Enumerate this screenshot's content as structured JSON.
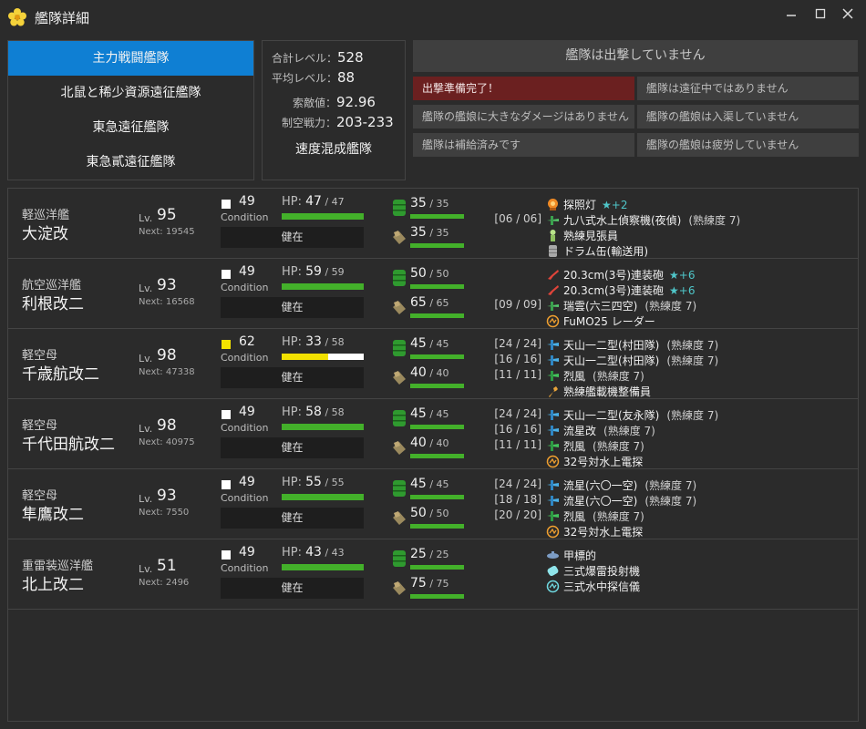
{
  "window": {
    "title": "艦隊詳細",
    "minimize": "─",
    "maximize": "☐",
    "close": "✕"
  },
  "fleets": [
    "主力戦闘艦隊",
    "北鼠と稀少資源遠征艦隊",
    "東急遠征艦隊",
    "東急貳遠征艦隊"
  ],
  "stats": {
    "total_level_label": "合計レベル：",
    "total_level": "528",
    "avg_level_label": "平均レベル：",
    "avg_level": "88",
    "los_label": "索敵値：",
    "los": "92.96",
    "air_label": "制空戦力：",
    "air": "203-233",
    "fleet_type": "速度混成艦隊"
  },
  "status": {
    "sortie": "艦隊は出撃していません",
    "ready": "出撃準備完了！",
    "expedition": "艦隊は遠征中ではありません",
    "damage": "艦隊の艦娘に大きなダメージはありません",
    "repair": "艦隊の艦娘は入渠していません",
    "supply": "艦隊は補給済みです",
    "fatigue": "艦隊の艦娘は疲労していません"
  },
  "labels": {
    "lv": "Lv.",
    "condition": "Condition",
    "hp": "HP:",
    "slash": " / "
  },
  "colors": {
    "accent": "#0f7fd3",
    "bar": "#43b02a",
    "alert": "#6b2020",
    "star": "#4fc6c9"
  },
  "ships": [
    {
      "type": "軽巡洋艦",
      "name": "大淀改",
      "lv": "95",
      "next": "Next: 19545",
      "cond": "49",
      "cond_color": "white",
      "status": "健在",
      "hp": "47",
      "hp_max": "47",
      "hp_fraction": 1.0,
      "hp_color": "green",
      "fuel": "35",
      "fuel_max": "35",
      "ammo": "35",
      "ammo_max": "35",
      "equip": [
        {
          "slot": "",
          "icon": "searchlight-icon",
          "name": "探照灯",
          "stars": "★+2",
          "prof": ""
        },
        {
          "slot": "[06 / 06]",
          "icon": "seaplane-icon",
          "name": "九八式水上偵察機(夜偵)",
          "stars": "",
          "prof": "(熟練度 7)"
        },
        {
          "slot": "",
          "icon": "lookout-icon",
          "name": "熟練見張員",
          "stars": "",
          "prof": ""
        },
        {
          "slot": "",
          "icon": "drum-icon",
          "name": "ドラム缶(輸送用)",
          "stars": "",
          "prof": ""
        }
      ]
    },
    {
      "type": "航空巡洋艦",
      "name": "利根改二",
      "lv": "93",
      "next": "Next: 16568",
      "cond": "49",
      "cond_color": "white",
      "status": "健在",
      "hp": "59",
      "hp_max": "59",
      "hp_fraction": 1.0,
      "hp_color": "green",
      "fuel": "50",
      "fuel_max": "50",
      "ammo": "65",
      "ammo_max": "65",
      "equip": [
        {
          "slot": "",
          "icon": "gun-icon",
          "name": "20.3cm(3号)連装砲",
          "stars": "★+6",
          "prof": ""
        },
        {
          "slot": "",
          "icon": "gun-icon",
          "name": "20.3cm(3号)連装砲",
          "stars": "★+6",
          "prof": ""
        },
        {
          "slot": "[09 / 09]",
          "icon": "seaplane-bomber-icon",
          "name": "瑞雲(六三四空)",
          "stars": "",
          "prof": "(熟練度 7)"
        },
        {
          "slot": "",
          "icon": "radar-icon",
          "name": "FuMO25 レーダー",
          "stars": "",
          "prof": ""
        }
      ]
    },
    {
      "type": "軽空母",
      "name": "千歳航改二",
      "lv": "98",
      "next": "Next: 47338",
      "cond": "62",
      "cond_color": "yellow",
      "status": "健在",
      "hp": "33",
      "hp_max": "58",
      "hp_fraction": 0.569,
      "hp_color": "yellow",
      "fuel": "45",
      "fuel_max": "45",
      "ammo": "40",
      "ammo_max": "40",
      "equip": [
        {
          "slot": "[24 / 24]",
          "icon": "torpedo-bomber-icon",
          "name": "天山一二型(村田隊)",
          "stars": "",
          "prof": "(熟練度 7)"
        },
        {
          "slot": "[16 / 16]",
          "icon": "torpedo-bomber-icon",
          "name": "天山一二型(村田隊)",
          "stars": "",
          "prof": "(熟練度 7)"
        },
        {
          "slot": "[11 / 11]",
          "icon": "fighter-icon",
          "name": "烈風",
          "stars": "",
          "prof": "(熟練度 7)"
        },
        {
          "slot": "",
          "icon": "wrench-icon",
          "name": "熟練艦載機整備員",
          "stars": "",
          "prof": ""
        }
      ]
    },
    {
      "type": "軽空母",
      "name": "千代田航改二",
      "lv": "98",
      "next": "Next: 40975",
      "cond": "49",
      "cond_color": "white",
      "status": "健在",
      "hp": "58",
      "hp_max": "58",
      "hp_fraction": 1.0,
      "hp_color": "green",
      "fuel": "45",
      "fuel_max": "45",
      "ammo": "40",
      "ammo_max": "40",
      "equip": [
        {
          "slot": "[24 / 24]",
          "icon": "torpedo-bomber-icon",
          "name": "天山一二型(友永隊)",
          "stars": "",
          "prof": "(熟練度 7)"
        },
        {
          "slot": "[16 / 16]",
          "icon": "torpedo-bomber-icon",
          "name": "流星改",
          "stars": "",
          "prof": "(熟練度 7)"
        },
        {
          "slot": "[11 / 11]",
          "icon": "fighter-icon",
          "name": "烈風",
          "stars": "",
          "prof": "(熟練度 7)"
        },
        {
          "slot": "",
          "icon": "radar-icon",
          "name": "32号対水上電探",
          "stars": "",
          "prof": ""
        }
      ]
    },
    {
      "type": "軽空母",
      "name": "隼鷹改二",
      "lv": "93",
      "next": "Next: 7550",
      "cond": "49",
      "cond_color": "white",
      "status": "健在",
      "hp": "55",
      "hp_max": "55",
      "hp_fraction": 1.0,
      "hp_color": "green",
      "fuel": "45",
      "fuel_max": "45",
      "ammo": "50",
      "ammo_max": "50",
      "equip": [
        {
          "slot": "[24 / 24]",
          "icon": "torpedo-bomber-icon",
          "name": "流星(六〇一空)",
          "stars": "",
          "prof": "(熟練度 7)"
        },
        {
          "slot": "[18 / 18]",
          "icon": "torpedo-bomber-icon",
          "name": "流星(六〇一空)",
          "stars": "",
          "prof": "(熟練度 7)"
        },
        {
          "slot": "[20 / 20]",
          "icon": "fighter-icon",
          "name": "烈風",
          "stars": "",
          "prof": "(熟練度 7)"
        },
        {
          "slot": "",
          "icon": "radar-icon",
          "name": "32号対水上電探",
          "stars": "",
          "prof": ""
        }
      ]
    },
    {
      "type": "重雷装巡洋艦",
      "name": "北上改二",
      "lv": "51",
      "next": "Next: 2496",
      "cond": "49",
      "cond_color": "white",
      "status": "健在",
      "hp": "43",
      "hp_max": "43",
      "hp_fraction": 1.0,
      "hp_color": "green",
      "fuel": "25",
      "fuel_max": "25",
      "ammo": "75",
      "ammo_max": "75",
      "equip": [
        {
          "slot": "",
          "icon": "midget-sub-icon",
          "name": "甲標的",
          "stars": "",
          "prof": ""
        },
        {
          "slot": "",
          "icon": "depth-charge-icon",
          "name": "三式爆雷投射機",
          "stars": "",
          "prof": ""
        },
        {
          "slot": "",
          "icon": "sonar-icon",
          "name": "三式水中探信儀",
          "stars": "",
          "prof": ""
        }
      ]
    }
  ]
}
